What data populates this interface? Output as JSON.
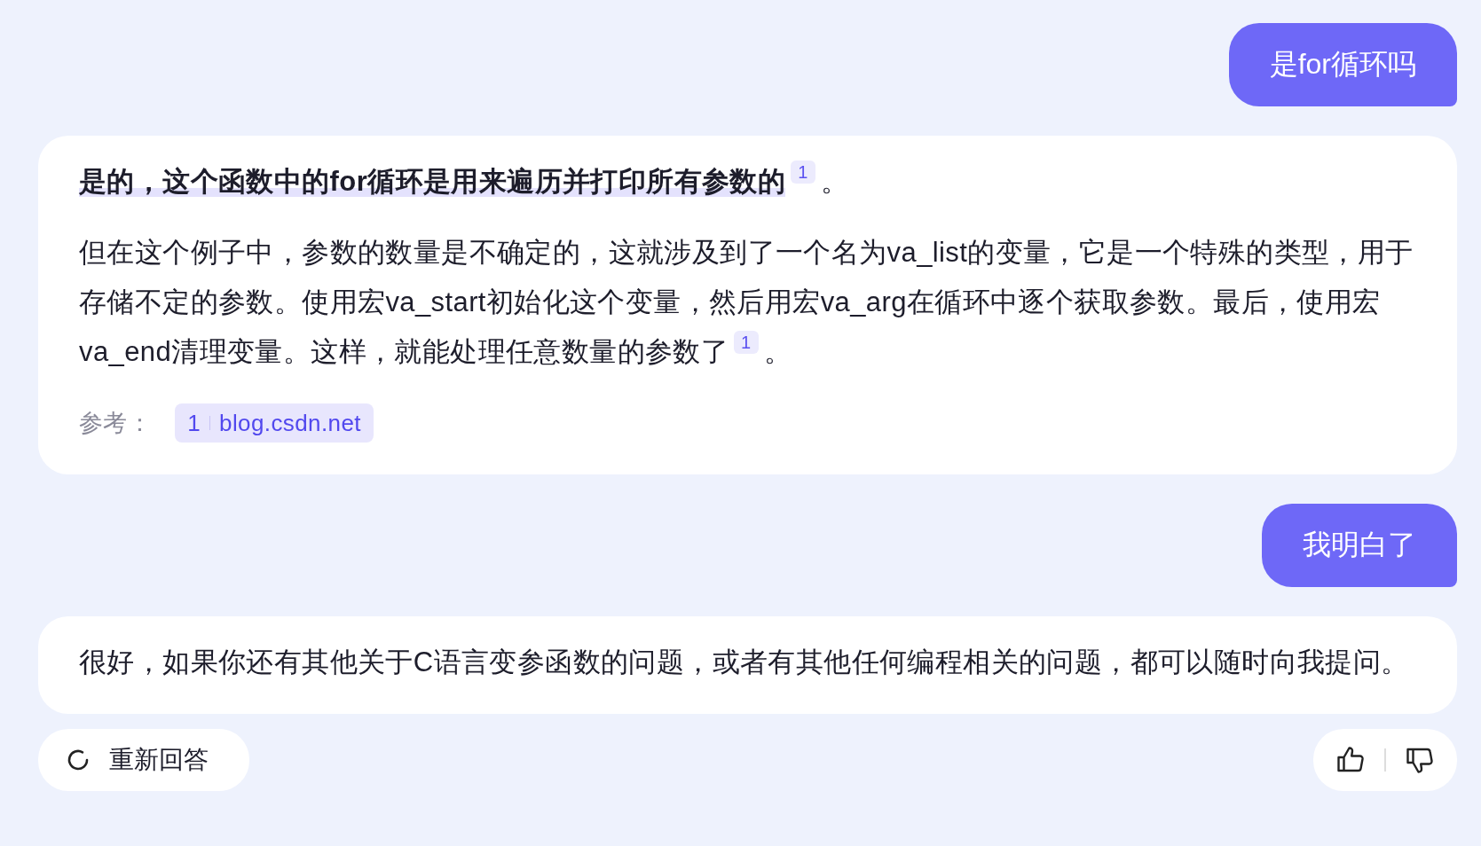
{
  "messages": [
    {
      "kind": "user",
      "text": "是for循环吗"
    },
    {
      "kind": "answer",
      "paragraphs": [
        {
          "kind": "heading",
          "text": "是的，这个函数中的for循环是用来遍历并打印所有参数的",
          "cite": "1",
          "tail": "。"
        },
        {
          "kind": "body",
          "text": "但在这个例子中，参数的数量是不确定的，这就涉及到了一个名为va_list的变量，它是一个特殊的类型，用于存储不定的参数。使用宏va_start初始化这个变量，然后用宏va_arg在循环中逐个获取参数。最后，使用宏va_end清理变量。这样，就能处理任意数量的参数了",
          "cite": "1",
          "tail": "。"
        }
      ],
      "references": {
        "label": "参考：",
        "items": [
          {
            "index": "1",
            "source": "blog.csdn.net"
          }
        ]
      }
    },
    {
      "kind": "user",
      "text": "我明白了"
    },
    {
      "kind": "answer",
      "paragraphs": [
        {
          "kind": "body",
          "text": "很好，如果你还有其他关于C语言变参函数的问题，或者有其他任何编程相关的问题，都可以随时向我提问。"
        }
      ]
    }
  ],
  "actions": {
    "regenerate": "重新回答"
  }
}
